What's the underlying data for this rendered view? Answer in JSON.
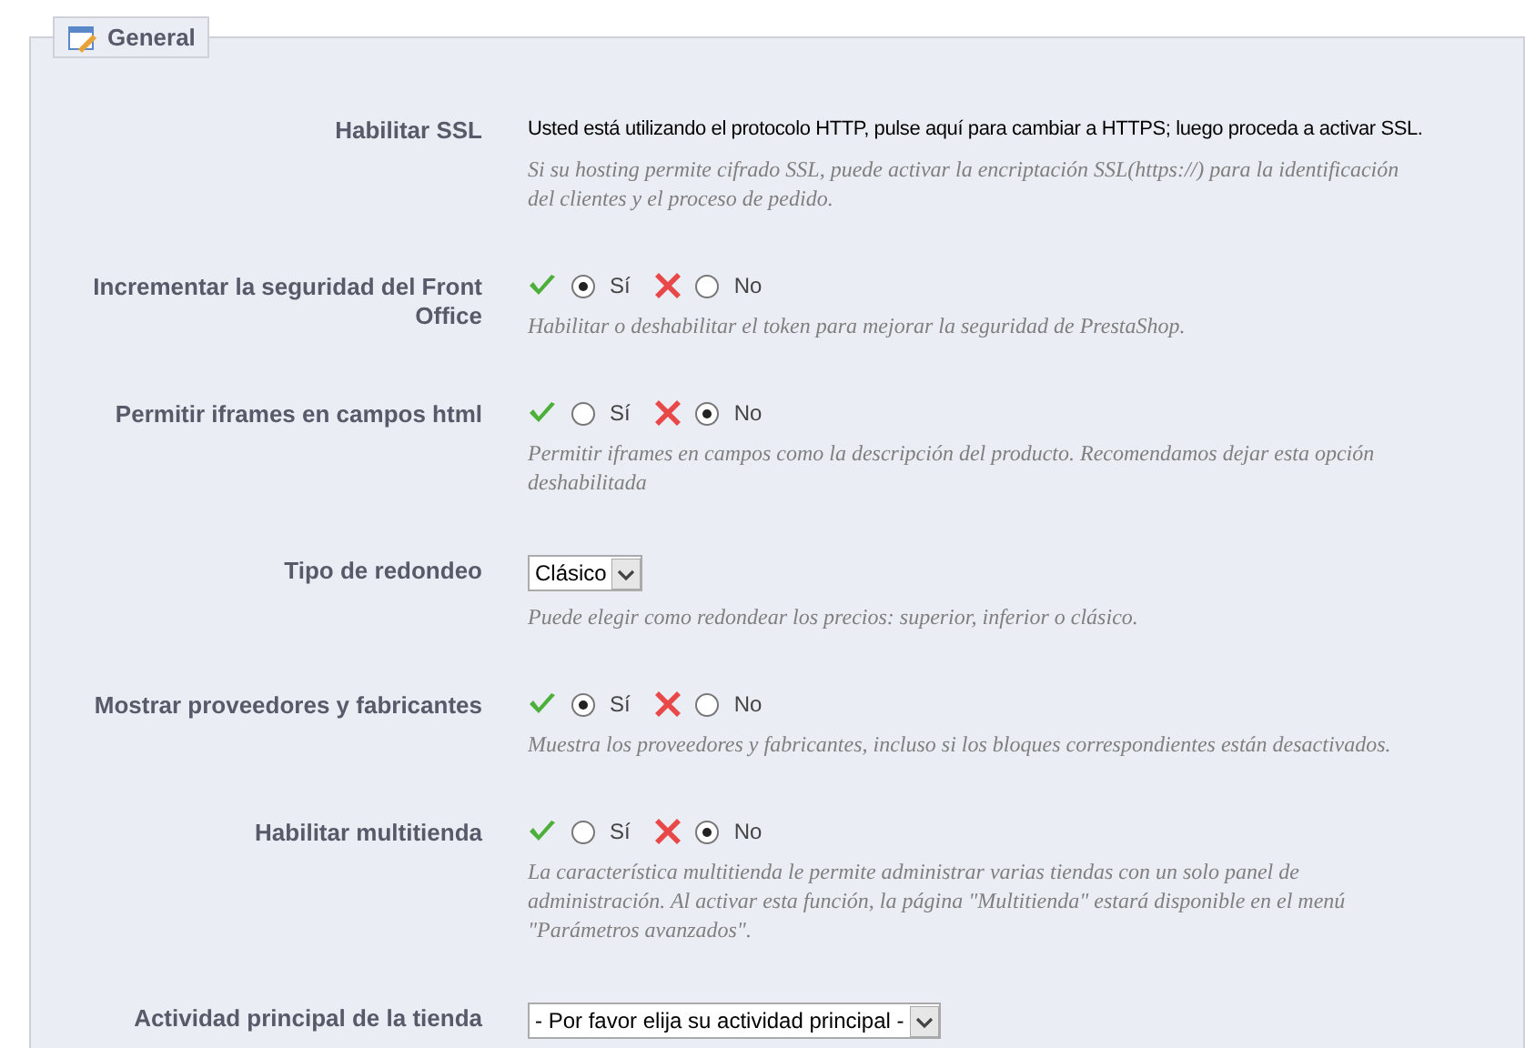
{
  "legend": "General",
  "rows": [
    {
      "kind": "text",
      "label": "Habilitar SSL",
      "text": "Usted está utilizando el protocolo HTTP, pulse aquí para cambiar a HTTPS; luego proceda a activar SSL.",
      "hint": "Si su hosting permite cifrado SSL, puede activar la encriptación SSL(https://) para la identificación del clientes y el proceso de pedido."
    },
    {
      "kind": "radio",
      "label": "Incrementar la seguridad del Front Office",
      "options": [
        {
          "label": "Sí",
          "selected": true
        },
        {
          "label": "No",
          "selected": false
        }
      ],
      "hint": "Habilitar o deshabilitar el token para mejorar la seguridad de PrestaShop."
    },
    {
      "kind": "radio",
      "label": "Permitir iframes en campos html",
      "options": [
        {
          "label": "Sí",
          "selected": false
        },
        {
          "label": "No",
          "selected": true
        }
      ],
      "hint": "Permitir iframes en campos como la descripción del producto. Recomendamos dejar esta opción deshabilitada"
    },
    {
      "kind": "select",
      "label": "Tipo de redondeo",
      "value": "Clásico",
      "hint": "Puede elegir como redondear los precios: superior, inferior o clásico."
    },
    {
      "kind": "radio",
      "label": "Mostrar proveedores y fabricantes",
      "options": [
        {
          "label": "Sí",
          "selected": true
        },
        {
          "label": "No",
          "selected": false
        }
      ],
      "hint": "Muestra los proveedores y fabricantes, incluso si los bloques correspondientes están desactivados."
    },
    {
      "kind": "radio",
      "label": "Habilitar multitienda",
      "options": [
        {
          "label": "Sí",
          "selected": false
        },
        {
          "label": "No",
          "selected": true
        }
      ],
      "hint": "La característica multitienda le permite administrar varias tiendas con un solo panel de administración. Al activar esta función, la página \"Multitienda\" estará disponible en el menú \"Parámetros avanzados\"."
    },
    {
      "kind": "select",
      "label": "Actividad principal de la tienda",
      "value": "- Por favor elija su actividad principal -"
    }
  ]
}
